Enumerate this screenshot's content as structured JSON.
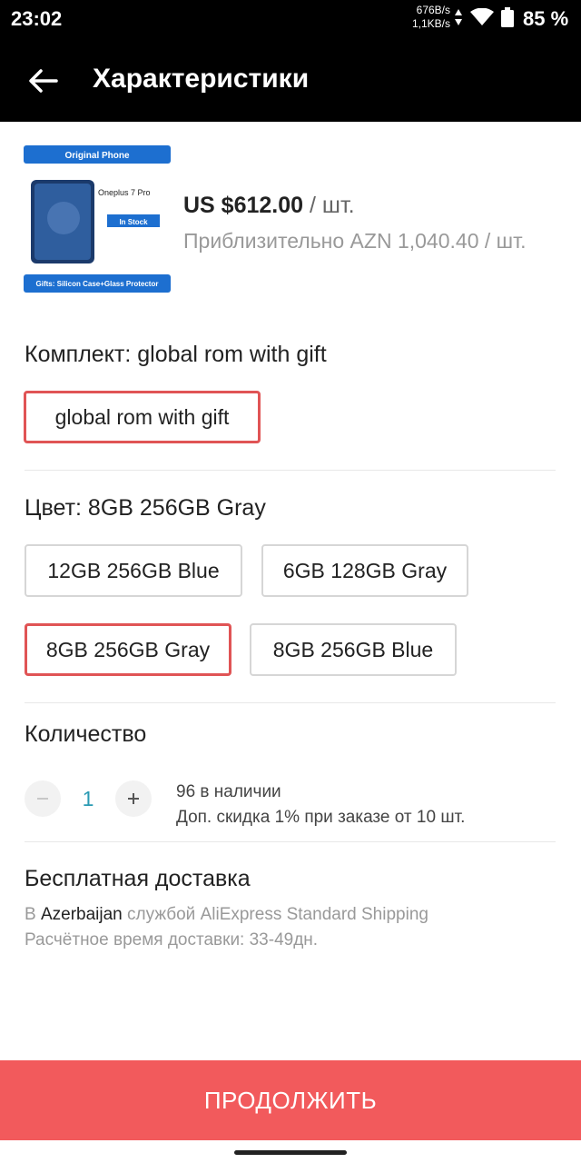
{
  "status_bar": {
    "time": "23:02",
    "net_speed_up": "676B/s",
    "net_speed_down": "1,1KB/s",
    "battery": "85 %"
  },
  "app_bar": {
    "title": "Характеристики"
  },
  "product": {
    "thumb_banner_top": "Original Phone",
    "thumb_model": "Oneplus 7 Pro",
    "thumb_badge": "In Stock",
    "thumb_banner_bottom": "Gifts: Silicon Case+Glass Protector",
    "price": "US $612.00",
    "price_unit": " / шт.",
    "approx_price": "Приблизительно AZN 1,040.40 / шт."
  },
  "bundle": {
    "label": "Комплект: global rom with gift",
    "options": [
      "global rom with gift"
    ],
    "selected_index": 0
  },
  "color": {
    "label": "Цвет: 8GB 256GB Gray",
    "options": [
      "12GB 256GB Blue",
      "6GB 128GB Gray",
      "8GB 256GB Gray",
      "8GB 256GB Blue"
    ],
    "selected_index": 2
  },
  "quantity": {
    "label": "Количество",
    "value": "1",
    "stock": "96 в наличии",
    "discount": "Доп. скидка 1% при заказе от 10 шт."
  },
  "shipping": {
    "title": "Бесплатная доставка",
    "prefix": "В ",
    "destination": "Azerbaijan",
    "service": " службой AliExpress Standard Shipping",
    "eta": "Расчётное время доставки: 33-49дн."
  },
  "cta": {
    "label": "ПРОДОЛЖИТЬ"
  },
  "colors": {
    "accent": "#f25a5c",
    "selected_border": "#e05455",
    "quantity_value": "#2a9ab3"
  }
}
